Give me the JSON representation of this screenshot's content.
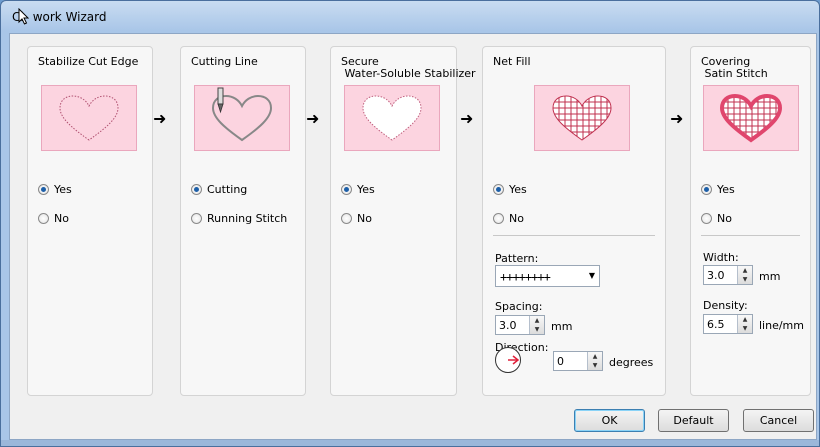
{
  "window": {
    "title": "Cl",
    "title_rest": "work Wizard"
  },
  "panels": [
    {
      "title": "Stabilize Cut Edge",
      "options": [
        {
          "label": "Yes",
          "selected": true
        },
        {
          "label": "No",
          "selected": false
        }
      ]
    },
    {
      "title": "Cutting Line",
      "options": [
        {
          "label": "Cutting",
          "selected": true
        },
        {
          "label": "Running Stitch",
          "selected": false
        }
      ]
    },
    {
      "title": "Secure\n Water-Soluble Stabilizer",
      "options": [
        {
          "label": "Yes",
          "selected": true
        },
        {
          "label": "No",
          "selected": false
        }
      ]
    },
    {
      "title": "Net Fill",
      "options": [
        {
          "label": "Yes",
          "selected": true
        },
        {
          "label": "No",
          "selected": false
        }
      ],
      "pattern_label": "Pattern:",
      "pattern_value": "++++++++",
      "spacing_label": "Spacing:",
      "spacing_value": "3.0",
      "spacing_unit": "mm",
      "direction_label": "Direction:",
      "direction_value": "0",
      "direction_unit": "degrees"
    },
    {
      "title": "Covering\n Satin Stitch",
      "options": [
        {
          "label": "Yes",
          "selected": true
        },
        {
          "label": "No",
          "selected": false
        }
      ],
      "width_label": "Width:",
      "width_value": "3.0",
      "width_unit": "mm",
      "density_label": "Density:",
      "density_value": "6.5",
      "density_unit": "line/mm"
    }
  ],
  "buttons": {
    "ok": "OK",
    "default": "Default",
    "cancel": "Cancel"
  },
  "icons": {
    "arrow": "right-arrow-icon",
    "cursor": "mouse-cursor-icon"
  },
  "colors": {
    "illustration_bg": "#fcd4e0",
    "heart_red": "#e0466d",
    "radio_selected": "#1d5fa8"
  }
}
